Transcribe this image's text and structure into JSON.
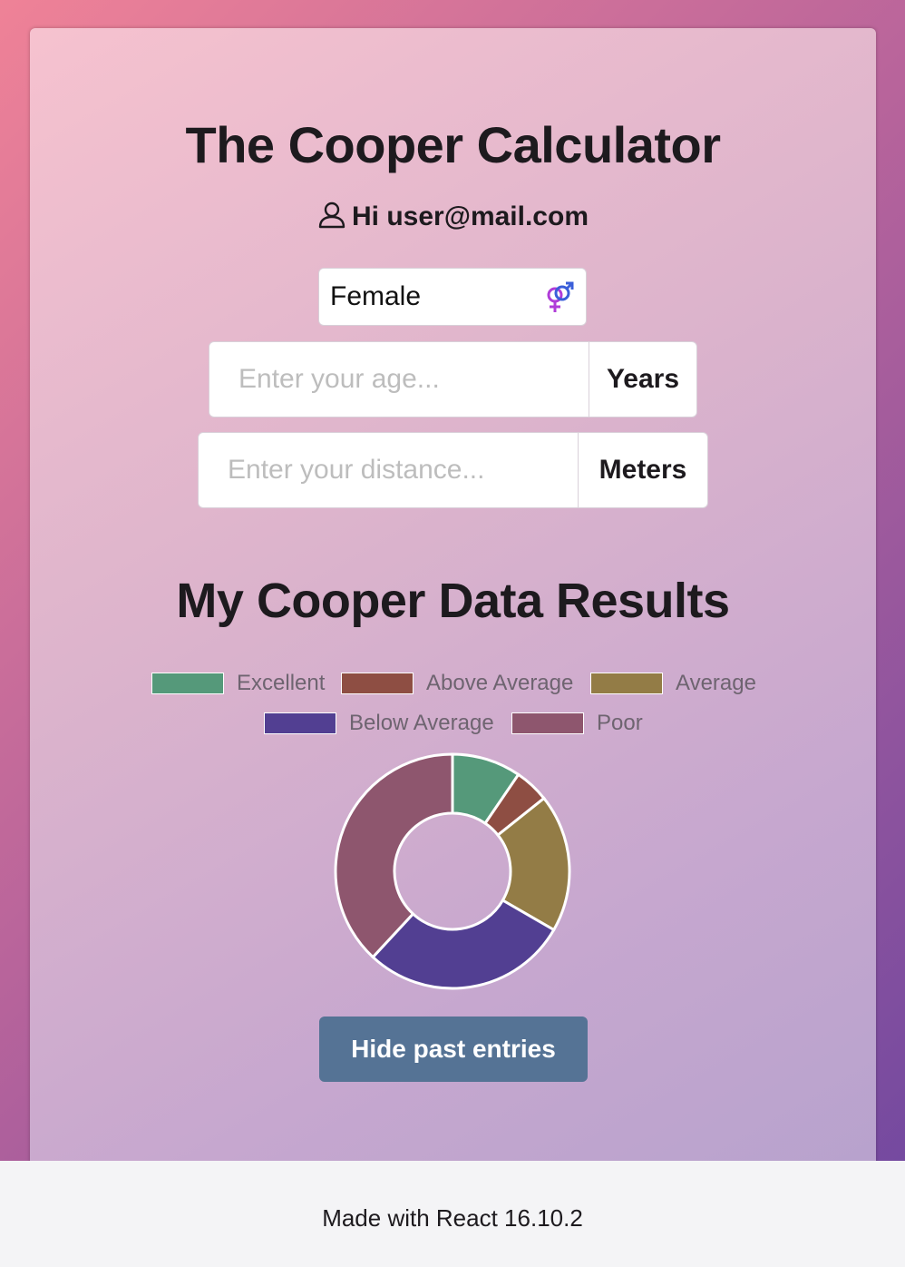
{
  "header": {
    "title": "The Cooper Calculator",
    "greeting": "Hi user@mail.com",
    "user_icon": "user-icon"
  },
  "form": {
    "gender": {
      "value": "Female",
      "icon": "gender-symbol-icon"
    },
    "age": {
      "placeholder": "Enter your age...",
      "unit": "Years"
    },
    "distance": {
      "placeholder": "Enter your distance...",
      "unit": "Meters"
    }
  },
  "results": {
    "title": "My Cooper Data Results",
    "button_label": "Hide past entries"
  },
  "chart_data": {
    "type": "pie",
    "subtype": "doughnut",
    "labels": [
      "Excellent",
      "Above Average",
      "Average",
      "Below Average",
      "Poor"
    ],
    "values": [
      1,
      0.5,
      2,
      3,
      4
    ],
    "colors": [
      "#55997a",
      "#8e4e43",
      "#937c46",
      "#523f92",
      "#8e566e"
    ],
    "legend_position": "top"
  },
  "footer": {
    "text": "Made with React 16.10.2"
  }
}
